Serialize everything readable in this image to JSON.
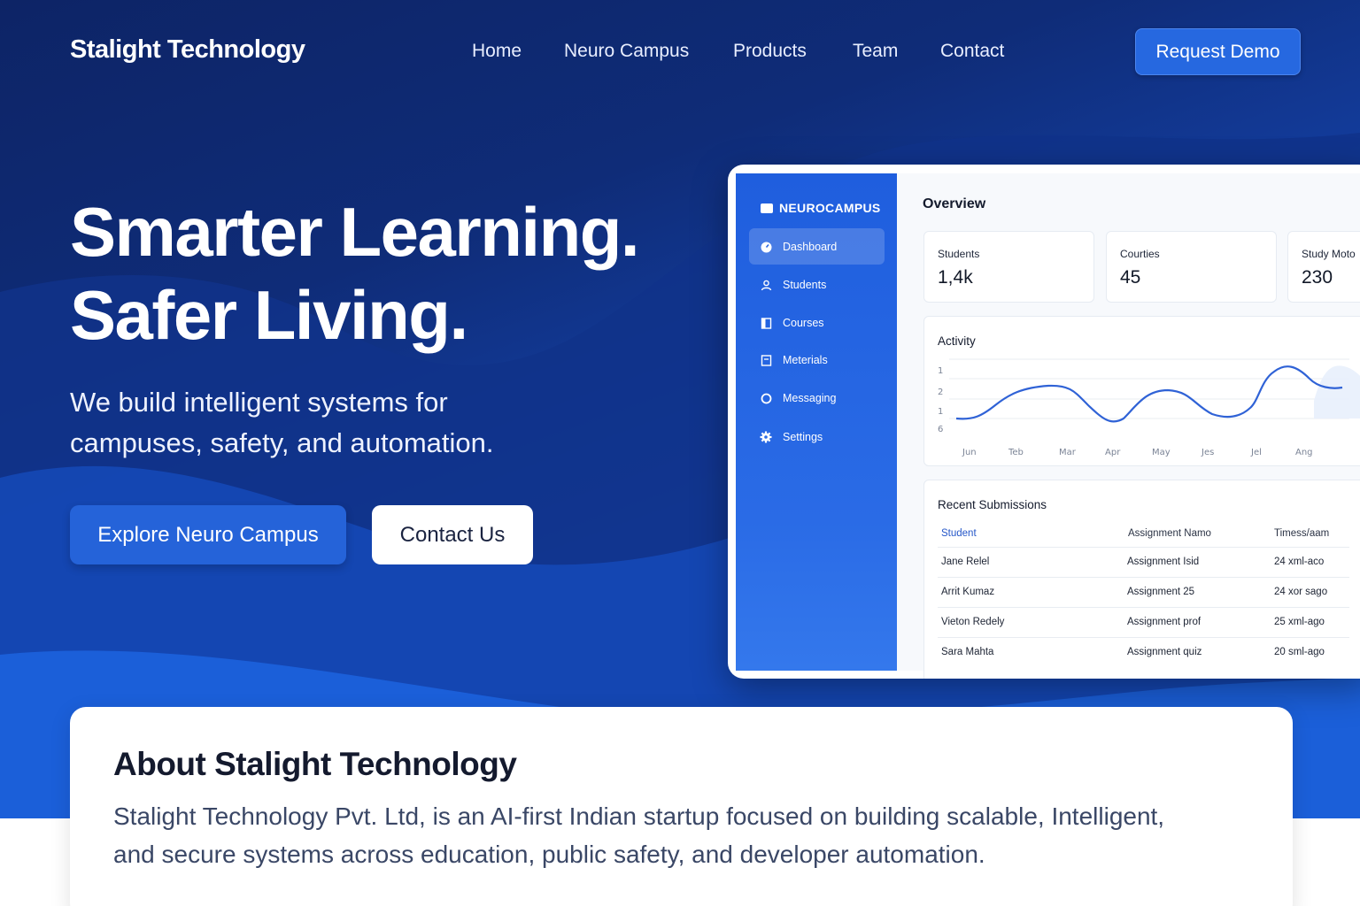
{
  "brand": "Stalight Technology",
  "nav": {
    "links": [
      "Home",
      "Neuro Campus",
      "Products",
      "Team",
      "Contact"
    ],
    "cta": "Request Demo"
  },
  "hero": {
    "headline_line1": "Smarter Learning.",
    "headline_line2": "Safer Living.",
    "subhead_line1": "We build intelligent systems for",
    "subhead_line2": "campuses, safety, and automation.",
    "primary_button": "Explore Neuro Campus",
    "secondary_button": "Contact Us"
  },
  "dashboard": {
    "logo": "NEUROCAMPUS",
    "sidebar": [
      {
        "label": "Dashboard",
        "icon": "dashboard-icon",
        "active": true
      },
      {
        "label": "Students",
        "icon": "user-icon",
        "active": false
      },
      {
        "label": "Courses",
        "icon": "book-icon",
        "active": false
      },
      {
        "label": "Meterials",
        "icon": "document-icon",
        "active": false
      },
      {
        "label": "Messaging",
        "icon": "circle-icon",
        "active": false
      },
      {
        "label": "Settings",
        "icon": "gear-icon",
        "active": false
      }
    ],
    "overview_title": "Overview",
    "stats": [
      {
        "label": "Students",
        "value": "1,4k"
      },
      {
        "label": "Courties",
        "value": "45"
      },
      {
        "label": "Study Moto",
        "value": "230"
      }
    ],
    "activity": {
      "title": "Activity",
      "y_ticks": [
        "1",
        "2",
        "1",
        "6"
      ],
      "x_ticks": [
        "Jun",
        "Teb",
        "Mar",
        "Apr",
        "May",
        "Jes",
        "Jel",
        "Ang"
      ]
    },
    "submissions": {
      "title": "Recent Submissions",
      "columns": [
        "Student",
        "Assignment Namo",
        "Timess/aam"
      ],
      "rows": [
        [
          "Jane Relel",
          "Assignment Isid",
          "24 хml-aco"
        ],
        [
          "Arrit Kumaz",
          "Assignment 25",
          "24 хor sago"
        ],
        [
          "Vieton Redely",
          "Assignment prof",
          "25 хml-ago"
        ],
        [
          "Sara Mahta",
          "Assignment quiz",
          "20 sml-ago"
        ]
      ]
    }
  },
  "about": {
    "title": "About Stalight Technology",
    "text_line1": "Stalight Technology Pvt. Ltd, is an AI-first Indian startup focused on building scalable, Intelligent,",
    "text_line2": "and secure systems across education, public safety, and developer automation."
  },
  "colors": {
    "hero_dark": "#0d2466",
    "hero_bright": "#1a5ad6",
    "accent": "#2563d9",
    "chart_line": "#2f62d6"
  }
}
